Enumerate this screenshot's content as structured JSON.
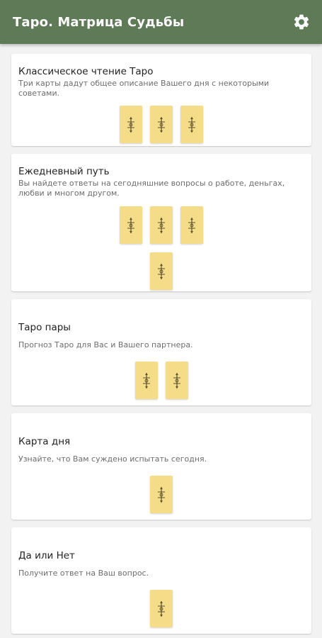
{
  "app": {
    "title": "Таро. Матрица Судьбы",
    "settings_icon": "gear-icon",
    "colors": {
      "appbar": "#5e7a57",
      "card_back": "#f4dc88",
      "background": "#f2f2f2"
    }
  },
  "readings": [
    {
      "title": "Классическое чтение Таро",
      "description": "Три карты дадут общее описание Вашего дня с некоторыми советами.",
      "card_count": 3
    },
    {
      "title": "Ежедневный путь",
      "description": "Вы найдете ответы на сегодняшние вопросы о работе, деньгах, любви и многом другом.",
      "card_count": 4
    },
    {
      "title": "Таро пары",
      "description": "Прогноз Таро для Вас и Вашего партнера.",
      "card_count": 2
    },
    {
      "title": "Карта дня",
      "description": "Узнайте, что Вам суждено испытать сегодня.",
      "card_count": 1
    },
    {
      "title": "Да или Нет",
      "description": "Получите ответ на Ваш вопрос.",
      "card_count": 1
    }
  ]
}
